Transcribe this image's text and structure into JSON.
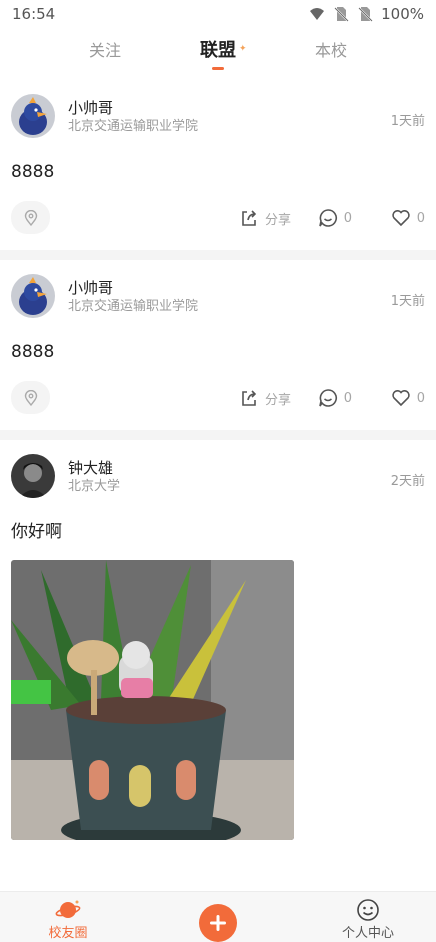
{
  "status_bar": {
    "time": "16:54",
    "battery": "100%"
  },
  "tabs": [
    {
      "label": "关注",
      "active": false
    },
    {
      "label": "联盟",
      "active": true
    },
    {
      "label": "本校",
      "active": false
    }
  ],
  "posts": [
    {
      "user": "小帅哥",
      "school": "北京交通运输职业学院",
      "time": "1天前",
      "text": "8888",
      "share_label": "分享",
      "comment_count": "0",
      "like_count": "0"
    },
    {
      "user": "小帅哥",
      "school": "北京交通运输职业学院",
      "time": "1天前",
      "text": "8888",
      "share_label": "分享",
      "comment_count": "0",
      "like_count": "0"
    },
    {
      "user": "钟大雄",
      "school": "北京大学",
      "time": "2天前",
      "text": "你好啊",
      "has_image": true
    }
  ],
  "bottom_nav": {
    "home_label": "校友圈",
    "me_label": "个人中心"
  },
  "colors": {
    "accent": "#f26b3a",
    "muted": "#9a9a9a",
    "separator": "#f4f4f4"
  },
  "icons": [
    "wifi-icon",
    "no-sim-icon",
    "location-pin-icon",
    "share-icon",
    "comment-icon",
    "heart-icon",
    "planet-icon",
    "plus-icon",
    "smiley-icon"
  ]
}
